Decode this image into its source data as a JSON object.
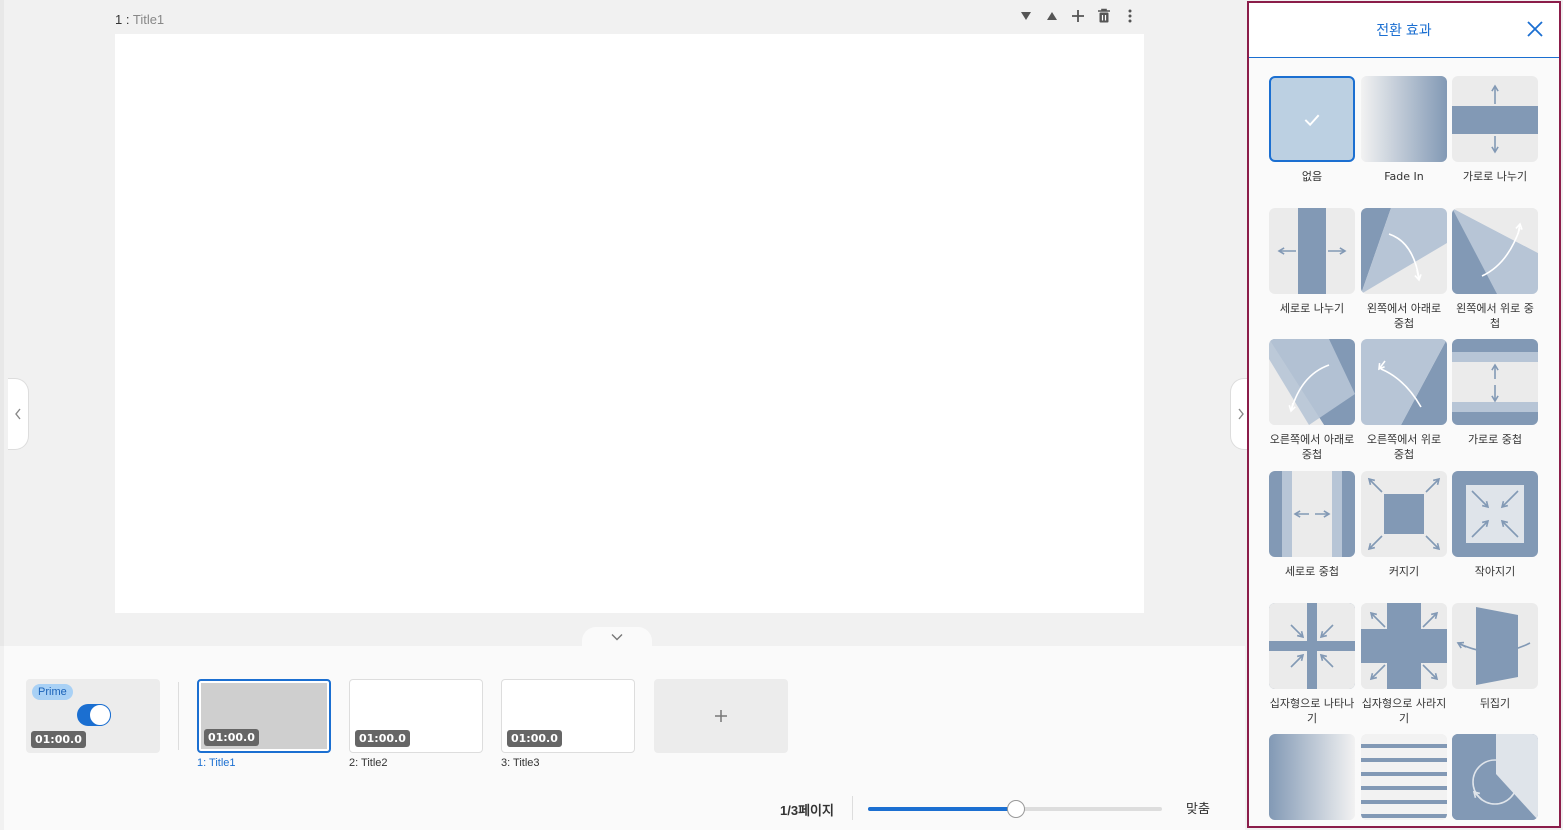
{
  "slide": {
    "number": "1 :",
    "title": "Title1"
  },
  "pagination": {
    "page_text": "1/3페이지",
    "fit_label": "맞춤",
    "zoom_percent": 50
  },
  "prime": {
    "badge": "Prime",
    "time": "01:00.0",
    "enabled": true
  },
  "thumbnails": [
    {
      "time": "01:00.0",
      "label": "1:  Title1",
      "active": true
    },
    {
      "time": "01:00.0",
      "label": "2:  Title2",
      "active": false
    },
    {
      "time": "01:00.0",
      "label": "3:  Title3",
      "active": false
    }
  ],
  "add_slide_icon": "plus-icon",
  "panel": {
    "title": "전환 효과",
    "close_icon": "close-icon",
    "effects": [
      {
        "label": "없음",
        "icon": "none-check",
        "selected": true
      },
      {
        "label": "Fade In",
        "icon": "fade-in"
      },
      {
        "label": "가로로 나누기",
        "icon": "split-horizontal"
      },
      {
        "label": "세로로 나누기",
        "icon": "split-vertical"
      },
      {
        "label": "왼쪽에서 아래로 중첩",
        "icon": "overlap-left-down"
      },
      {
        "label": "왼쪽에서 위로 중첩",
        "icon": "overlap-left-up"
      },
      {
        "label": "오른쪽에서 아래로 중첩",
        "icon": "overlap-right-down"
      },
      {
        "label": "오른쪽에서 위로 중첩",
        "icon": "overlap-right-up"
      },
      {
        "label": "가로로 중첩",
        "icon": "overlap-horizontal"
      },
      {
        "label": "세로로 중첩",
        "icon": "overlap-vertical"
      },
      {
        "label": "커지기",
        "icon": "zoom-in"
      },
      {
        "label": "작아지기",
        "icon": "zoom-out"
      },
      {
        "label": "십자형으로 나타나기",
        "icon": "cross-appear"
      },
      {
        "label": "십자형으로 사라지기",
        "icon": "cross-disappear"
      },
      {
        "label": "뒤집기",
        "icon": "flip"
      },
      {
        "label": "",
        "icon": "gradient-fade"
      },
      {
        "label": "",
        "icon": "blinds"
      },
      {
        "label": "",
        "icon": "rotate"
      }
    ]
  },
  "colors": {
    "accent": "#1b6fd1",
    "panel_border": "#8b1d4a",
    "effect_blue": "#8299b5",
    "effect_light": "#b7c5d6"
  }
}
